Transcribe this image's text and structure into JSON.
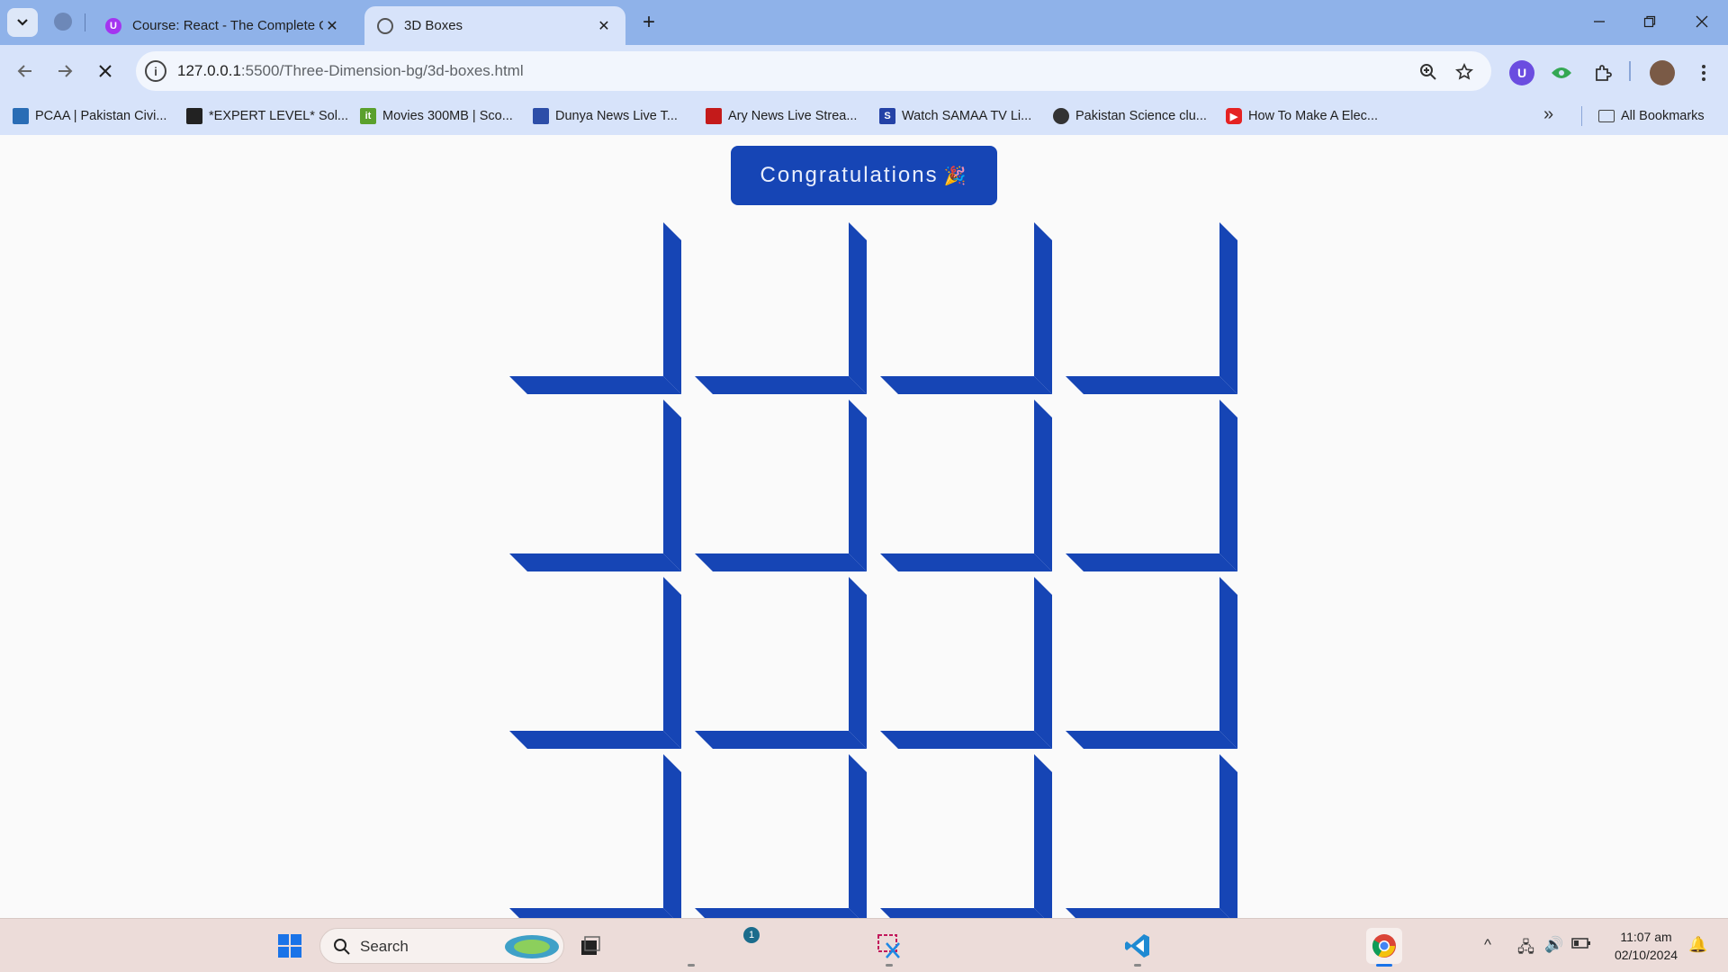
{
  "browser": {
    "tabs": [
      {
        "title": "Course: React - The Complete G",
        "favicon": "udemy-icon",
        "active": false
      },
      {
        "title": "3D Boxes",
        "favicon": "loading-icon",
        "active": true
      }
    ],
    "close_glyph": "✕",
    "new_tab_glyph": "+",
    "address": {
      "host": "127.0.0.1",
      "path": ":5500/Three-Dimension-bg/3d-boxes.html"
    },
    "bookmarks": [
      {
        "label": "PCAA | Pakistan Civi...",
        "icon": "pcaa-icon",
        "color": "#2a6db5"
      },
      {
        "label": "*EXPERT LEVEL* Sol...",
        "icon": "expert-icon",
        "color": "#222222"
      },
      {
        "label": "Movies 300MB | Sco...",
        "icon": "movies-icon",
        "color": "#5aa02c"
      },
      {
        "label": "Dunya News Live T...",
        "icon": "dunya-icon",
        "color": "#2d4ea8"
      },
      {
        "label": "Ary News Live Strea...",
        "icon": "ary-icon",
        "color": "#c41a1a"
      },
      {
        "label": "Watch SAMAA TV Li...",
        "icon": "samaa-icon",
        "color": "#2442a6"
      },
      {
        "label": "Pakistan Science clu...",
        "icon": "globe-icon",
        "color": "#333333"
      },
      {
        "label": "How To Make A Elec...",
        "icon": "youtube-icon",
        "color": "#e52222"
      }
    ],
    "all_bookmarks": "All Bookmarks"
  },
  "page": {
    "button_label": "Congratulations",
    "button_emoji": "🎉",
    "box_color": "#1645b5",
    "grid": {
      "rows": 4,
      "cols": 4
    }
  },
  "taskbar": {
    "search_label": "Search",
    "notification_count": "1",
    "time": "11:07 am",
    "date": "02/10/2024"
  }
}
